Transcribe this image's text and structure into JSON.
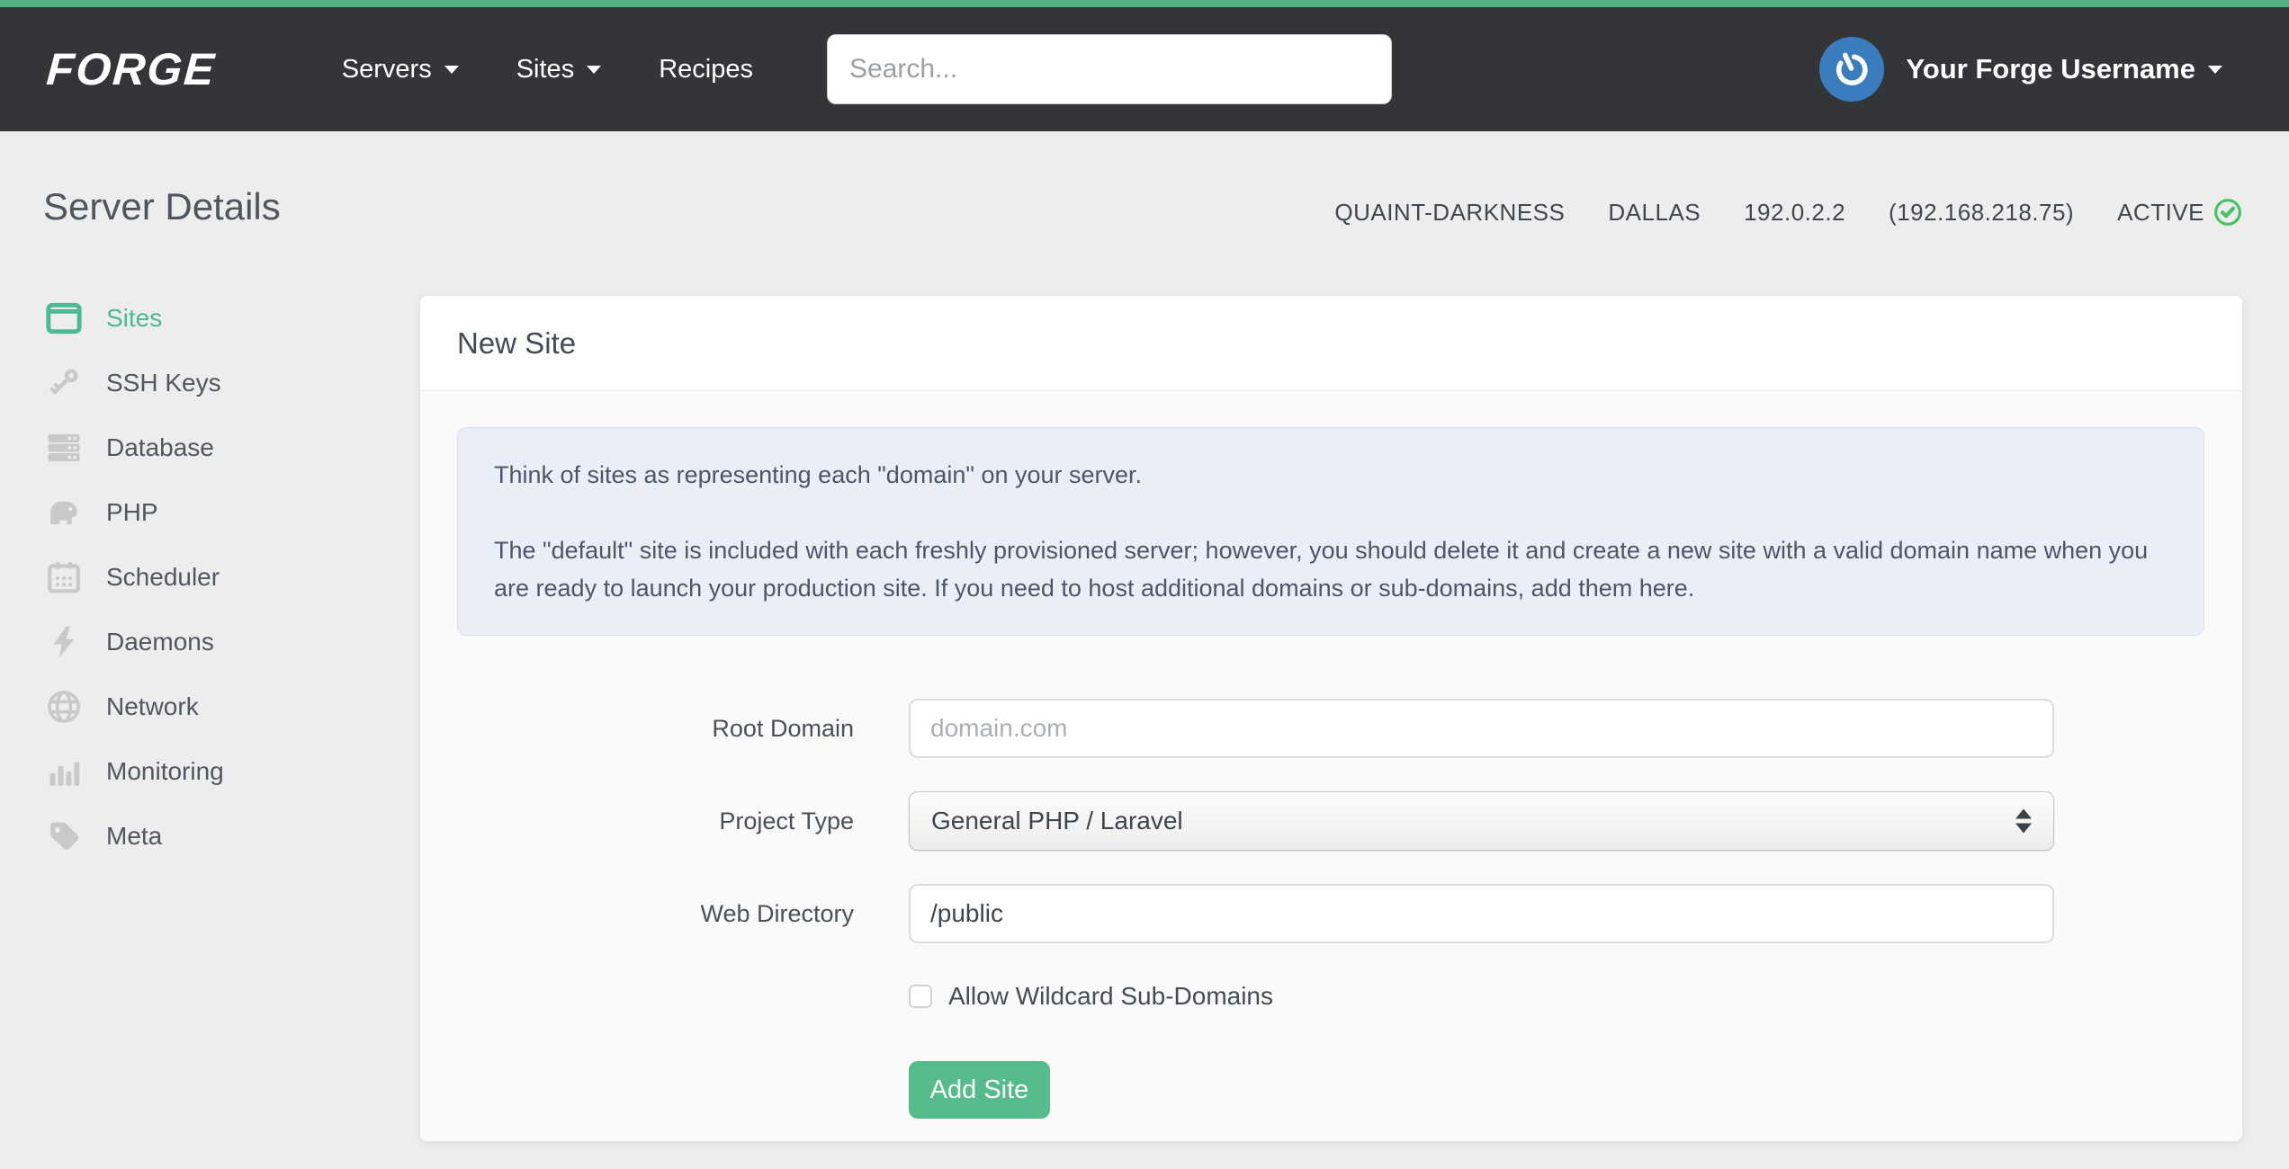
{
  "brand": {
    "logo_text": "FORGE"
  },
  "nav": {
    "items": [
      {
        "label": "Servers",
        "has_caret": true
      },
      {
        "label": "Sites",
        "has_caret": true
      },
      {
        "label": "Recipes",
        "has_caret": false
      }
    ],
    "search_placeholder": "Search...",
    "user": {
      "name": "Your Forge Username"
    }
  },
  "page": {
    "title": "Server Details"
  },
  "server_meta": {
    "name": "QUAINT-DARKNESS",
    "region": "DALLAS",
    "ip": "192.0.2.2",
    "private_ip": "(192.168.218.75)",
    "status": "ACTIVE"
  },
  "sidebar": {
    "items": [
      {
        "label": "Sites",
        "icon": "browser-window-icon",
        "active": true
      },
      {
        "label": "SSH Keys",
        "icon": "key-icon",
        "active": false
      },
      {
        "label": "Database",
        "icon": "database-icon",
        "active": false
      },
      {
        "label": "PHP",
        "icon": "elephant-icon",
        "active": false
      },
      {
        "label": "Scheduler",
        "icon": "calendar-icon",
        "active": false
      },
      {
        "label": "Daemons",
        "icon": "bolt-icon",
        "active": false
      },
      {
        "label": "Network",
        "icon": "globe-icon",
        "active": false
      },
      {
        "label": "Monitoring",
        "icon": "bar-chart-icon",
        "active": false
      },
      {
        "label": "Meta",
        "icon": "tag-icon",
        "active": false
      }
    ]
  },
  "card": {
    "title": "New Site",
    "alert": {
      "p1": "Think of sites as representing each \"domain\" on your server.",
      "p2": "The \"default\" site is included with each freshly provisioned server; however, you should delete it and create a new site with a valid domain name when you are ready to launch your production site. If you need to host additional domains or sub-domains, add them here."
    },
    "form": {
      "root_domain": {
        "label": "Root Domain",
        "placeholder": "domain.com",
        "value": ""
      },
      "project_type": {
        "label": "Project Type",
        "value": "General PHP / Laravel"
      },
      "web_directory": {
        "label": "Web Directory",
        "value": "/public"
      },
      "wildcard": {
        "label": "Allow Wildcard Sub-Domains",
        "checked": false
      },
      "submit_label": "Add Site"
    }
  },
  "colors": {
    "brand-green": "#53b184",
    "active-green": "#4db892",
    "button-green": "#56bb8a",
    "status-green": "#4cc065",
    "navbar-bg": "#343539",
    "avatar-blue": "#3a7dbf",
    "alert-bg": "#e9eef7",
    "alert-border": "#d8e0f0",
    "page-bg": "#ededee",
    "icon-gray": "#c9c9c9"
  }
}
